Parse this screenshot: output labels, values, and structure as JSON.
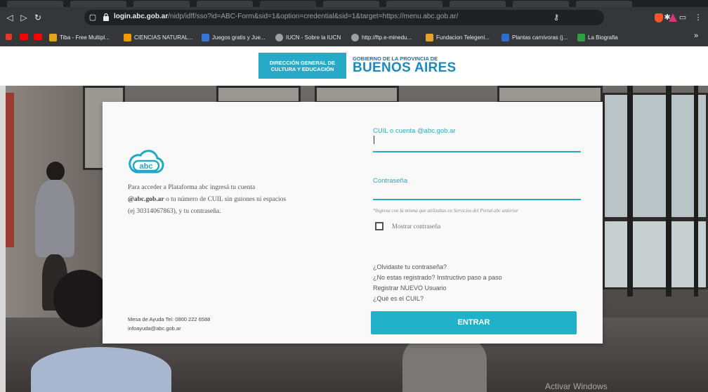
{
  "browser": {
    "url_host": "login.abc.gob.ar",
    "url_rest": "/nidp/idff/sso?id=ABC-Form&sid=1&option=credential&sid=1&target=https://menu.abc.gob.ar/",
    "bookmarks": [
      {
        "label": "Tiba - Free Multipl...",
        "color": "#e5a31a"
      },
      {
        "label": "CIENCIAS NATURAL...",
        "color": "#f29900"
      },
      {
        "label": "Juegos gratis y Jue...",
        "color": "#3b73d9"
      },
      {
        "label": "IUCN - Sobre la IUCN",
        "color": "#9aa0a6"
      },
      {
        "label": "http://ftp.e-minedu...",
        "color": "#9aa0a6"
      },
      {
        "label": "Fundacion Telegeni...",
        "color": "#e4a32a"
      },
      {
        "label": "Plantas carnivoras (j...",
        "color": "#2b6fc8"
      },
      {
        "label": "La Biografia",
        "color": "#2e9e44"
      }
    ]
  },
  "header": {
    "logo_line1": "DIRECCIÓN GENERAL DE",
    "logo_line2": "CULTURA Y EDUCACIÓN",
    "gob_label": "GOBIERNO DE LA PROVINCIA DE",
    "province": "BUENOS AIRES"
  },
  "card": {
    "logo_text": "abc",
    "intro_part1": "Para acceder a Plataforma abc ingresá tu cuenta",
    "intro_bold1": "@abc.gob.ar",
    "intro_part2": " o tu número de CUIL sin guiones ni espacios",
    "intro_part3": "(ej 30314067863), y tu contraseña.",
    "help_phone": "Mesa de Ayuda Tel: 0800 222 6588",
    "help_email": "infoayuda@abc.gob.ar",
    "user_label": "CUIL o cuenta @abc.gob.ar",
    "user_value": "",
    "password_label": "Contraseña",
    "password_value": "",
    "password_hint": "*Ingresa con la misma que utilizabas en Servicios del Portal abc anterior",
    "show_password_label": "Mostrar contraseña",
    "show_password_checked": false,
    "links": [
      "¿Olvidaste tu contraseña?",
      "¿No estas registrado? Instructivo paso a paso",
      "Registrar NUEVO Usuario",
      "¿Qué es el CUIL?"
    ],
    "submit_label": "ENTRAR"
  },
  "os": {
    "watermark": "Activar Windows"
  },
  "colors": {
    "accent": "#27a9c7",
    "button": "#21b1c9",
    "brand_blue": "#1b8ac4"
  }
}
